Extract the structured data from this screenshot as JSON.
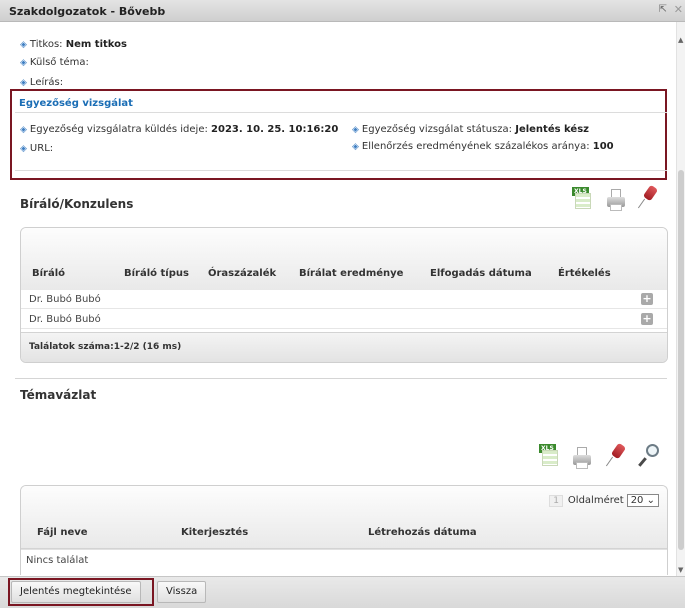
{
  "window": {
    "title": "Szakdolgozatok - Bővebb"
  },
  "general": {
    "titkos_label": "Titkos:",
    "titkos_value": "Nem titkos",
    "kulso_tema_label": "Külső téma:",
    "leiras_label": "Leírás:"
  },
  "similarity": {
    "title": "Egyezőség vizsgálat",
    "sent_label": "Egyezőség vizsgálatra küldés ideje:",
    "sent_value": "2023. 10. 25. 10:16:20",
    "url_label": "URL:",
    "status_label": "Egyezőség vizsgálat státusza:",
    "status_value": "Jelentés kész",
    "ratio_label": "Ellenőrzés eredményének százalékos aránya:",
    "ratio_value": "100"
  },
  "reviewers": {
    "title": "Bíráló/Konzulens",
    "columns": [
      "Bíráló",
      "Bíráló típus",
      "Óraszázalék",
      "Bírálat eredménye",
      "Elfogadás dátuma",
      "Értékelés"
    ],
    "rows": [
      {
        "name": "Dr. Bubó Bubó"
      },
      {
        "name": "Dr. Bubó Bubó"
      }
    ],
    "footer": "Találatok száma:1-2/2 (16 ms)"
  },
  "outline": {
    "title": "Témavázlat",
    "page_number": "1",
    "page_size_label": "Oldalméret",
    "page_size_value": "20",
    "columns": [
      "Fájl neve",
      "Kiterjesztés",
      "Létrehozás dátuma"
    ],
    "empty": "Nincs találat"
  },
  "buttons": {
    "report": "Jelentés megtekintése",
    "back": "Vissza"
  },
  "icons": {
    "excel": "XLS"
  },
  "colors": {
    "accent": "#1a6db5",
    "highlight": "#7a1622",
    "diamond": "#3f7fc3"
  }
}
